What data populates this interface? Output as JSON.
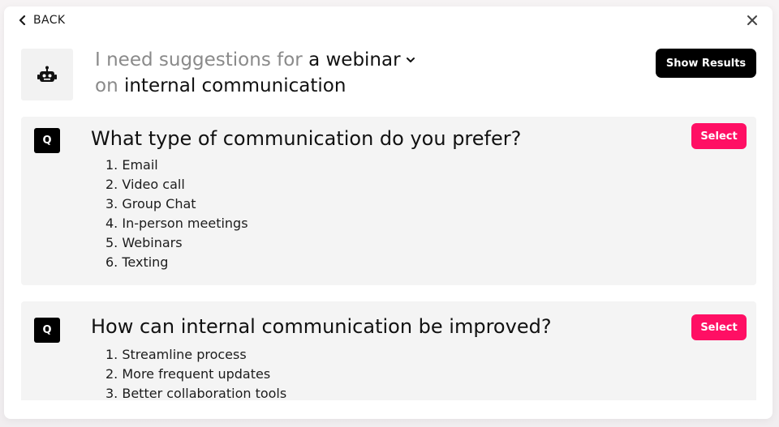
{
  "nav": {
    "back_label": "BACK"
  },
  "prompt": {
    "prefix": "I need suggestions for",
    "topic_type": "a webinar",
    "connector": "on",
    "subject": "internal communication"
  },
  "actions": {
    "show_results_label": "Show Results"
  },
  "questions": [
    {
      "badge": "Q",
      "question": "What type of communication do you prefer?",
      "select_label": "Select",
      "options": [
        "Email",
        "Video call",
        "Group Chat",
        "In-person meetings",
        "Webinars",
        "Texting"
      ]
    },
    {
      "badge": "Q",
      "question": "How can internal communication be improved?",
      "select_label": "Select",
      "options": [
        "Streamline process",
        "More frequent updates",
        "Better collaboration tools"
      ]
    }
  ],
  "colors": {
    "accent": "#ff0f64",
    "primary_button": "#000000",
    "card_bg": "#f4f4f4"
  },
  "icons": {
    "back": "chevron-left-icon",
    "close": "close-icon",
    "bot": "robot-icon",
    "dropdown": "chevron-down-icon"
  }
}
